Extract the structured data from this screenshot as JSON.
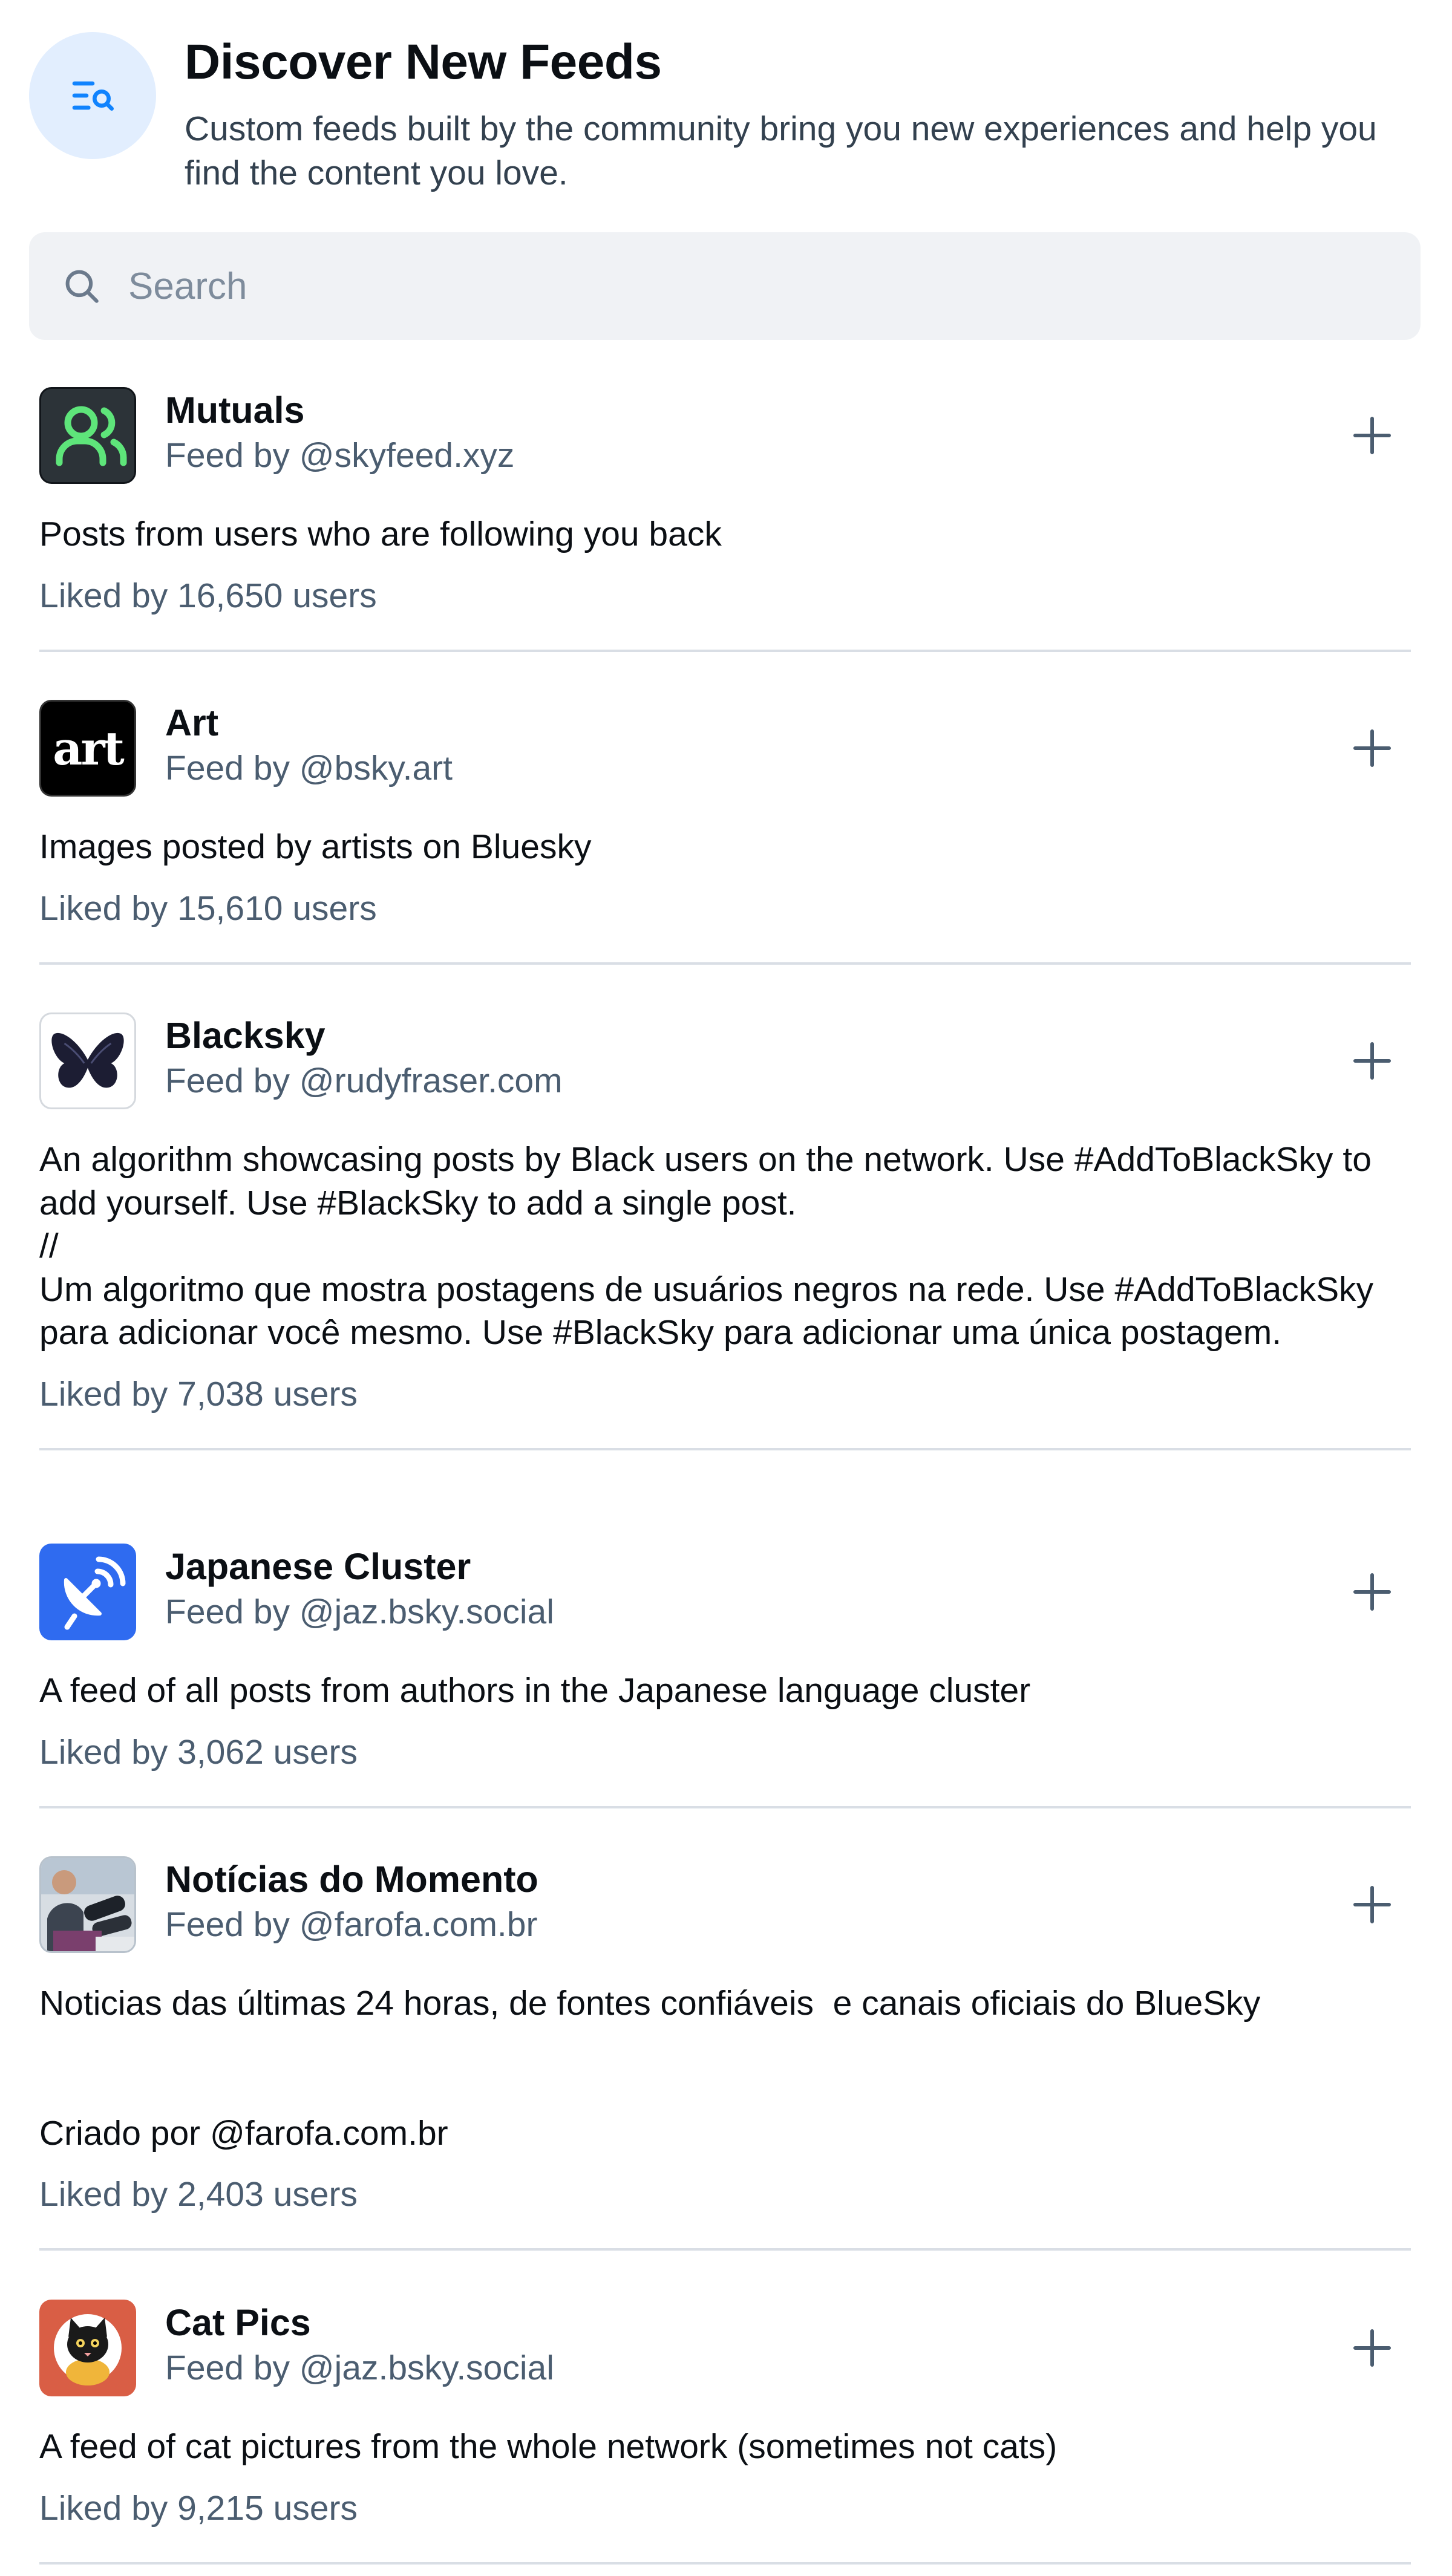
{
  "header": {
    "title": "Discover New Feeds",
    "subtitle": "Custom feeds built by the community bring you new experiences and help you find the content you love.",
    "icon": "list-search-icon"
  },
  "search": {
    "placeholder": "Search",
    "value": "",
    "icon": "search-icon"
  },
  "colors": {
    "accent": "#1083fe",
    "icon_bg": "#e2eefe",
    "muted": "#4b5d70",
    "divider": "#d9dee5"
  },
  "feeds": [
    {
      "name": "Mutuals",
      "creator": "Feed by @skyfeed.xyz",
      "description": "Posts from users who are following you back",
      "likes": "Liked by 16,650 users",
      "avatar_icon": "users-icon"
    },
    {
      "name": "Art",
      "creator": "Feed by @bsky.art",
      "description": "Images posted by artists on Bluesky",
      "likes": "Liked by 15,610 users",
      "avatar_icon": "art-logo-icon",
      "avatar_text": "art"
    },
    {
      "name": "Blacksky",
      "creator": "Feed by @rudyfraser.com",
      "description": "An algorithm showcasing posts by Black users on the network. Use #AddToBlackSky to add yourself. Use #BlackSky to add a single post.\n//\nUm algoritmo que mostra postagens de usuários negros na rede. Use #AddToBlackSky para adicionar você mesmo. Use #BlackSky para adicionar uma única postagem.",
      "likes": "Liked by 7,038 users",
      "avatar_icon": "butterfly-icon"
    },
    {
      "name": "Japanese Cluster",
      "creator": "Feed by @jaz.bsky.social",
      "description": "A feed of all posts from authors in the Japanese language cluster",
      "likes": "Liked by 3,062 users",
      "avatar_icon": "satellite-dish-icon"
    },
    {
      "name": "Notícias do Momento",
      "creator": "Feed by @farofa.com.br",
      "description": "Noticias das últimas 24 horas, de fontes confiáveis  e canais oficiais do BlueSky\n\n\nCriado por @farofa.com.br",
      "likes": "Liked by 2,403 users",
      "avatar_icon": "news-photo-icon"
    },
    {
      "name": "Cat Pics",
      "creator": "Feed by @jaz.bsky.social",
      "description": "A feed of cat pictures from the whole network (sometimes not cats)",
      "likes": "Liked by 9,215 users",
      "avatar_icon": "cat-icon"
    }
  ]
}
